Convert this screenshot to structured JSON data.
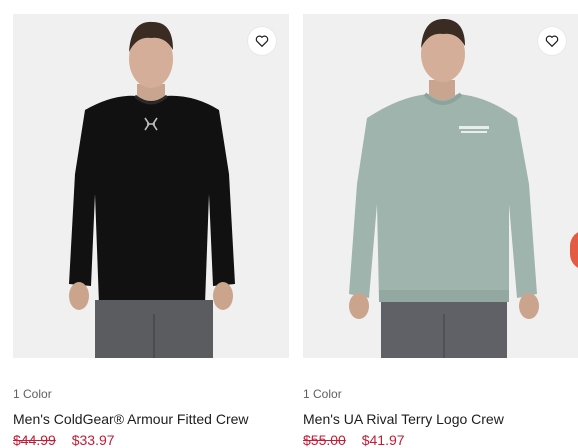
{
  "products": [
    {
      "color_count": "1 Color",
      "name": "Men's ColdGear® Armour Fitted Crew",
      "price_original": "$44.99",
      "price_sale": "$33.97",
      "shirt_color": "#111111",
      "icons": {
        "favorite": "heart-outline-icon",
        "logo": "ua-logo-icon"
      }
    },
    {
      "color_count": "1 Color",
      "name": "Men's UA Rival Terry Logo Crew",
      "price_original": "$55.00",
      "price_sale": "$41.97",
      "shirt_color": "#9fb4ac",
      "icons": {
        "favorite": "heart-outline-icon"
      }
    }
  ],
  "colors": {
    "image_background": "#f1f0f0",
    "sale_price": "#c11d37",
    "text": "#1d1d1d",
    "muted": "#5f5f5f"
  }
}
